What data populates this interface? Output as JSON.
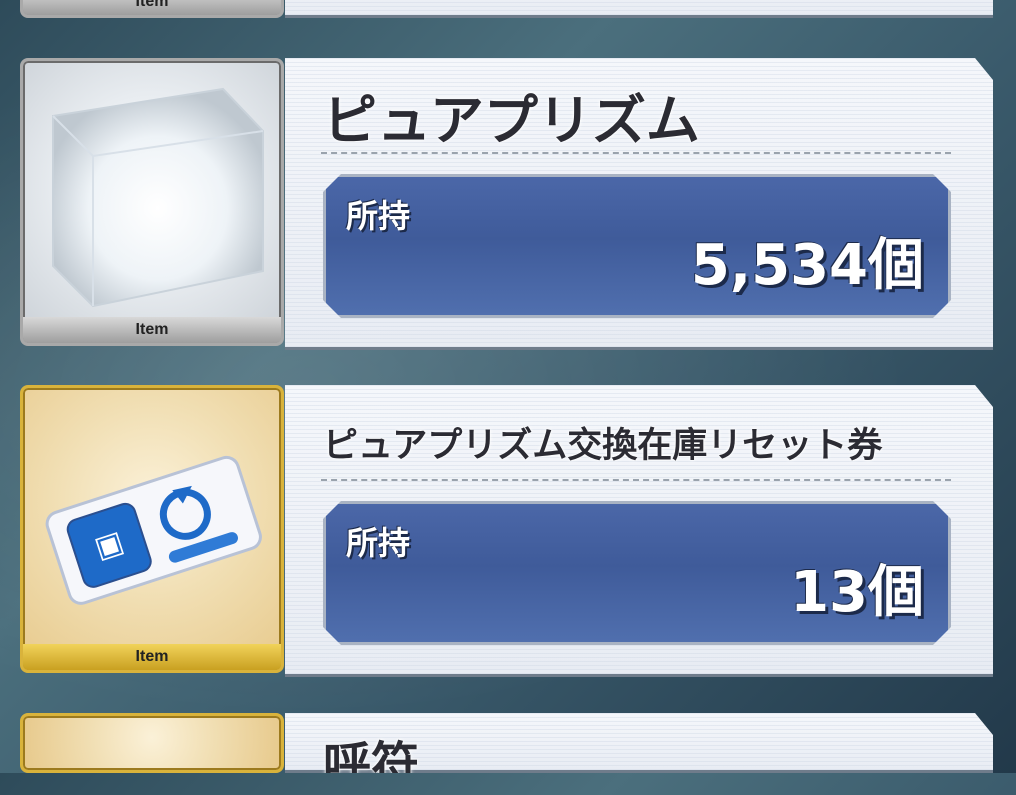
{
  "items": [
    {
      "tag": "Item",
      "name": "",
      "count": ""
    },
    {
      "tag": "Item",
      "name": "ピュアプリズム",
      "owned_label": "所持",
      "count": "5,534個"
    },
    {
      "tag": "Item",
      "name": "ピュアプリズム交換在庫リセット券",
      "owned_label": "所持",
      "count": "13個"
    },
    {
      "tag": "",
      "name": "呼符",
      "count": ""
    }
  ]
}
